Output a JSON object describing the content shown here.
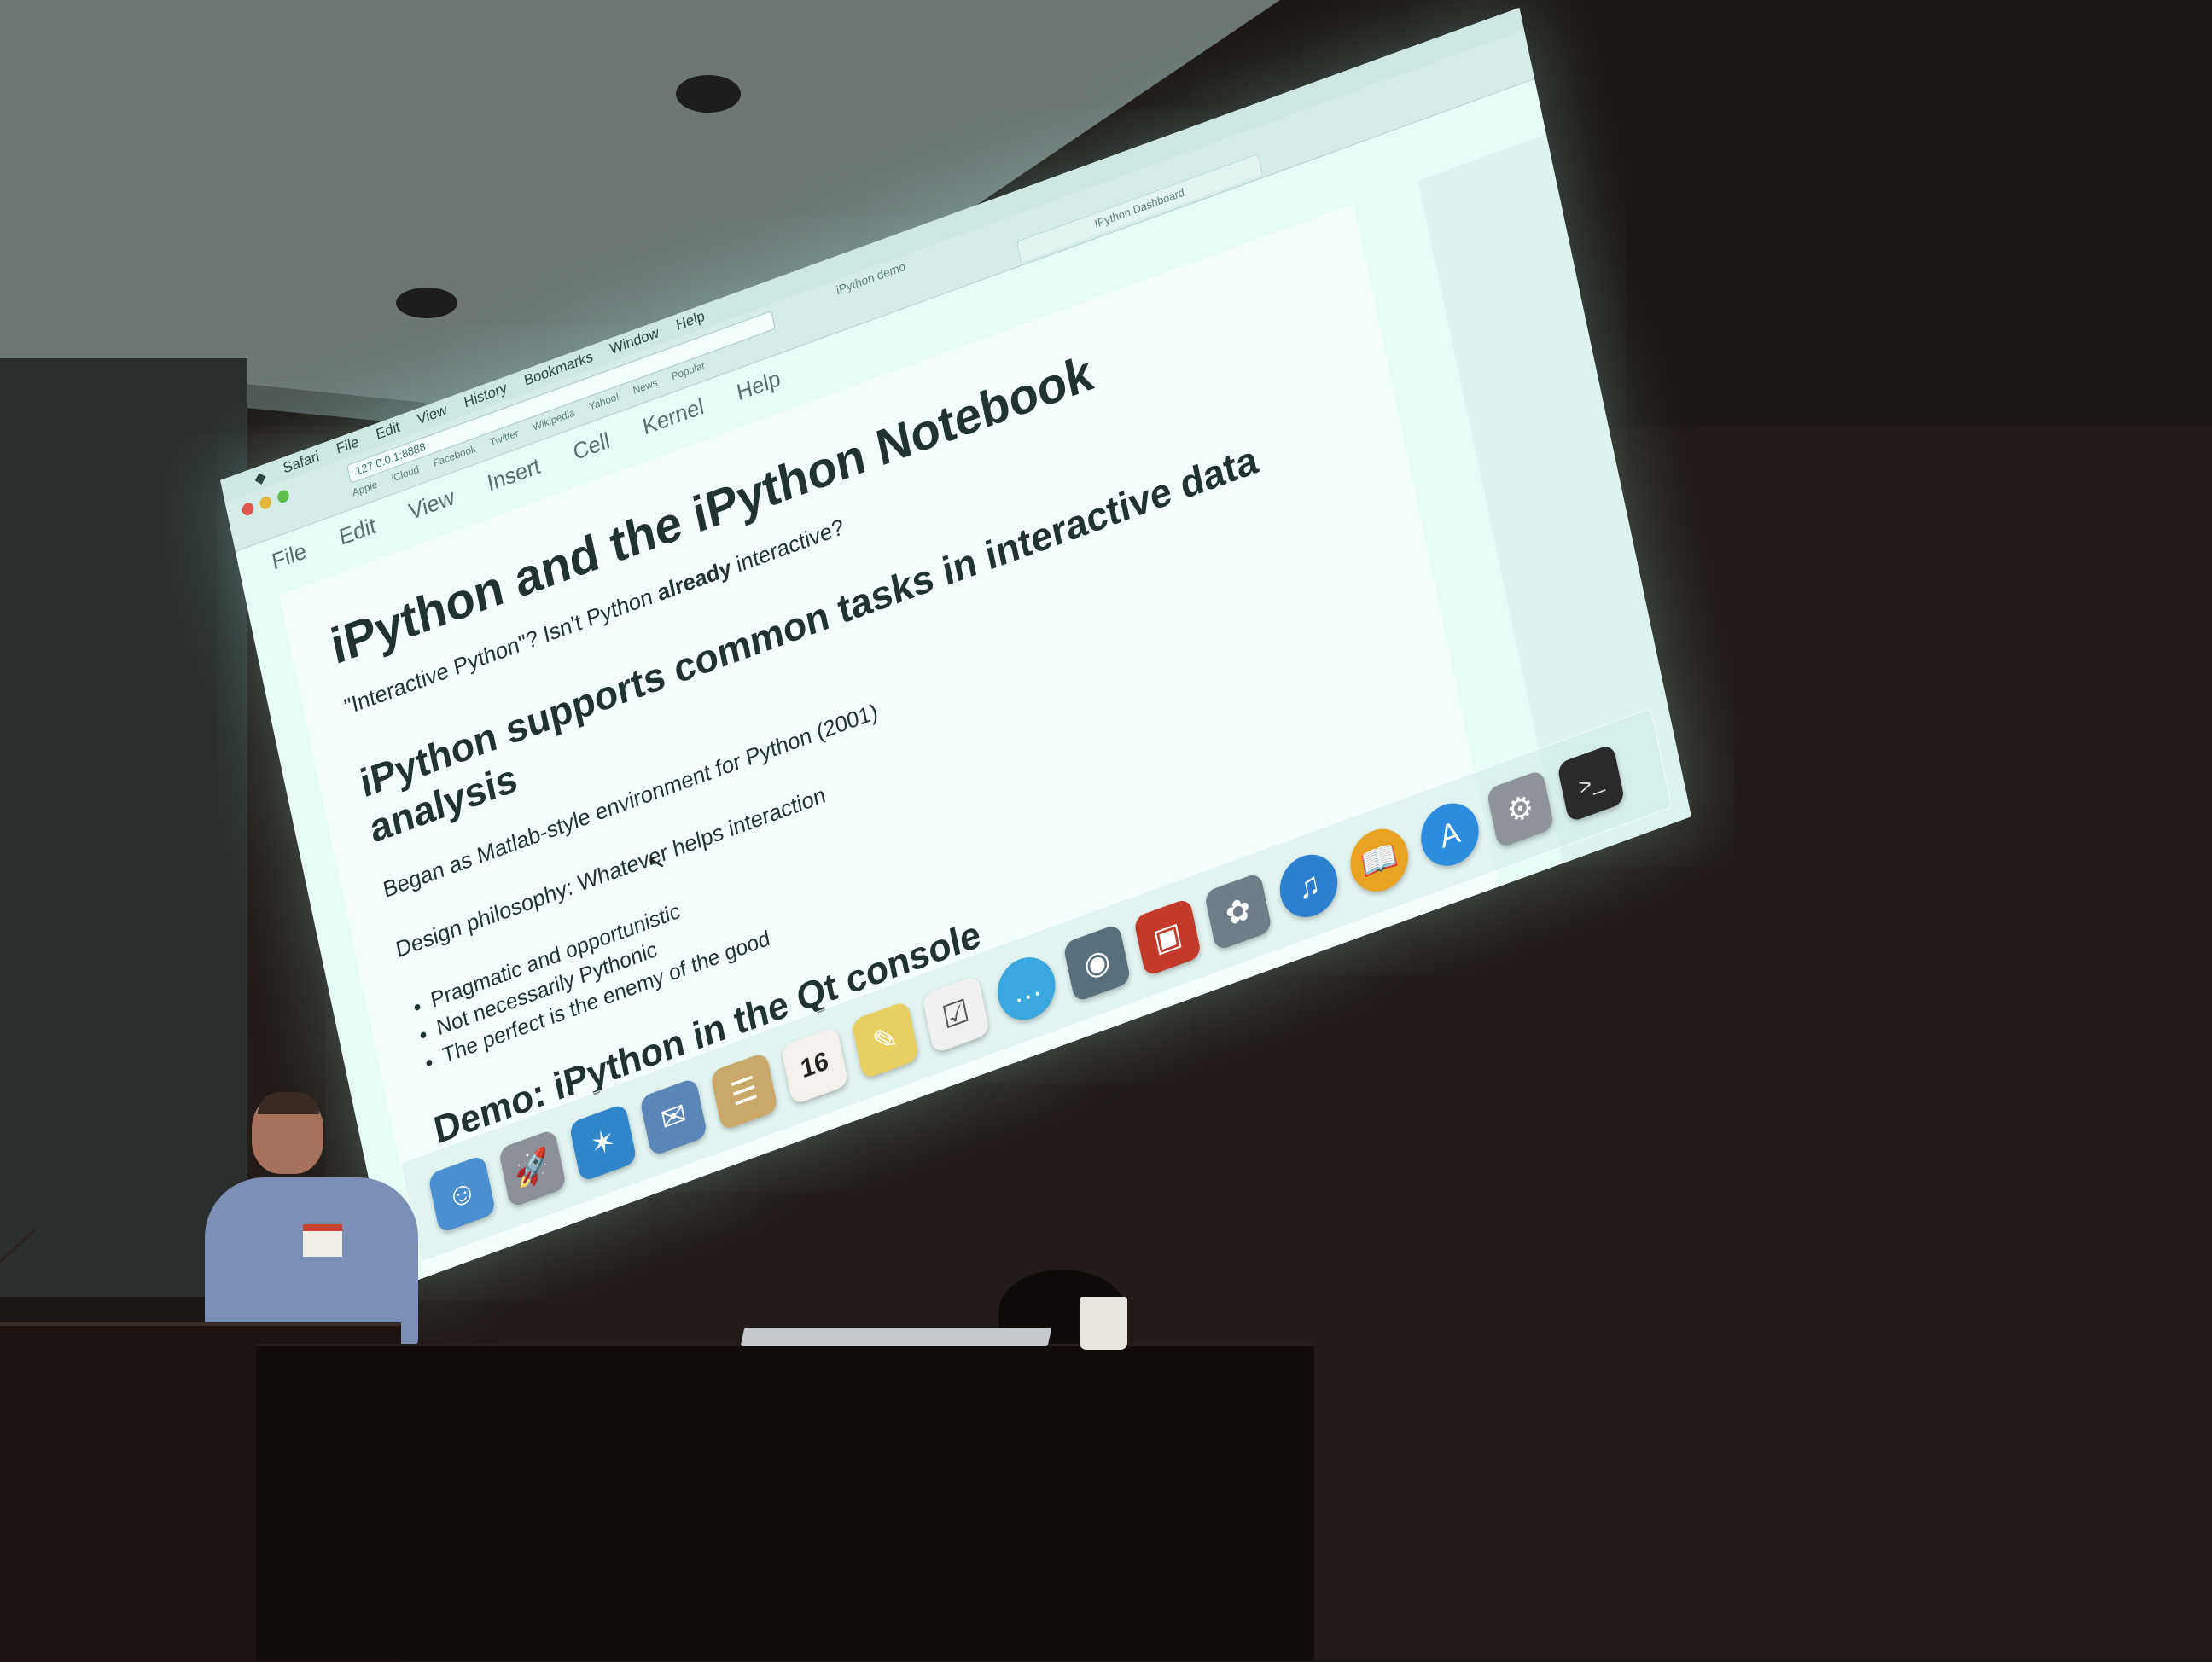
{
  "scene": {
    "colors": {
      "wall": "#1c1714",
      "ceiling": "#6d7876",
      "screen_glow": "#e7fbf7",
      "slide_text": "#203331",
      "presenter_shirt": "#7c8fb6"
    }
  },
  "mac_menubar": {
    "apple_icon": "apple-icon",
    "items": [
      "Safari",
      "File",
      "Edit",
      "View",
      "History",
      "Bookmarks",
      "Window",
      "Help"
    ]
  },
  "browser": {
    "url": "127.0.0.1:8888",
    "window_title": "iPython demo",
    "tab_label": "IPython Dashboard",
    "bookmarks": [
      "Apple",
      "iCloud",
      "Facebook",
      "Twitter",
      "Wikipedia",
      "Yahoo!",
      "News",
      "Popular"
    ]
  },
  "notebook": {
    "menu": [
      "File",
      "Edit",
      "View",
      "Insert",
      "Cell",
      "Kernel",
      "Help"
    ],
    "title": "iPython and the iPython Notebook",
    "intro_before": "\"Interactive Python\"? Isn't Python ",
    "intro_bold": "already",
    "intro_after": " interactive?",
    "h2": "iPython supports common tasks in interactive data analysis",
    "para1": "Began as Matlab-style environment for Python (2001)",
    "para2": "Design philosophy: Whatever helps interaction",
    "bullets": [
      "Pragmatic and opportunistic",
      "Not necessarily Pythonic",
      "The perfect is the enemy of the good"
    ],
    "next_heading": "Demo: iPython in the Qt console"
  },
  "dock": {
    "calendar_day": "16",
    "icons": [
      {
        "name": "finder-icon",
        "glyph": "☺",
        "color": "#4a8fd0"
      },
      {
        "name": "launchpad-icon",
        "glyph": "🚀",
        "color": "#8a8f98"
      },
      {
        "name": "safari-icon",
        "glyph": "✶",
        "color": "#2f86c8"
      },
      {
        "name": "mail-icon",
        "glyph": "✉",
        "color": "#5a86b8"
      },
      {
        "name": "contacts-icon",
        "glyph": "☰",
        "color": "#c9a86a"
      },
      {
        "name": "calendar-icon",
        "glyph": "",
        "color": "#f4f1ec"
      },
      {
        "name": "notes-icon",
        "glyph": "✎",
        "color": "#e9cf62"
      },
      {
        "name": "reminders-icon",
        "glyph": "☑",
        "color": "#f0f0f0"
      },
      {
        "name": "messages-icon",
        "glyph": "…",
        "color": "#3aa8e0"
      },
      {
        "name": "facetime-icon",
        "glyph": "◉",
        "color": "#5a6f7c"
      },
      {
        "name": "photo-booth-icon",
        "glyph": "▣",
        "color": "#c43a2a"
      },
      {
        "name": "iphoto-icon",
        "glyph": "✿",
        "color": "#6f7f8a"
      },
      {
        "name": "itunes-icon",
        "glyph": "♫",
        "color": "#2d7fd0"
      },
      {
        "name": "ibooks-icon",
        "glyph": "📖",
        "color": "#e8a323"
      },
      {
        "name": "app-store-icon",
        "glyph": "A",
        "color": "#2c8de0"
      },
      {
        "name": "system-preferences-icon",
        "glyph": "⚙",
        "color": "#8e9499"
      },
      {
        "name": "terminal-icon",
        "glyph": ">_",
        "color": "#2a2a2a"
      }
    ],
    "right_icons": [
      {
        "name": "applications-folder-icon",
        "glyph": "▤",
        "color": "#7fb6d4"
      },
      {
        "name": "downloads-stack-icon",
        "glyph": "▦",
        "color": "#e6eef2"
      },
      {
        "name": "trash-icon",
        "glyph": "🗑",
        "color": "#9aa2a6"
      }
    ]
  }
}
